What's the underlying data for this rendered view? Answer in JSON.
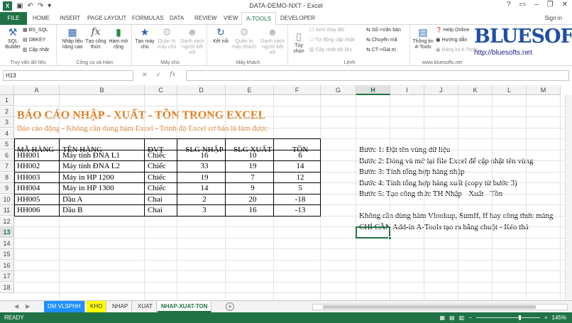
{
  "window": {
    "title": "DATA-DEMO-NXT - Excel",
    "signin": "Sign in"
  },
  "tabs": [
    "FILE",
    "HOME",
    "INSERT",
    "PAGE LAYOUT",
    "FORMULAS",
    "DATA",
    "REVIEW",
    "VIEW",
    "A-TOOLS",
    "DEVELOPER"
  ],
  "active_tab": "A-TOOLS",
  "ribbon": {
    "g1": {
      "sql_builder": "SQL Builder",
      "bs_sql": "BS_SQL",
      "dbkey": "DBKEY",
      "update": "Cập nhật",
      "label": "Truy vấn dữ liệu"
    },
    "g2": {
      "nhap_lieu": "Nhập liệu nâng cao",
      "tao_cong_thuc": "Tạo công thức",
      "ham_mo_rong": "Hàm mở rộng",
      "label": "Công cụ và Hàm"
    },
    "g3": {
      "tao_may_chu": "Tạo máy chủ",
      "quan_tri": "Quản trị máy chủ",
      "danh_sach": "Danh sách người kết nối",
      "label": "Máy chủ"
    },
    "g4": {
      "ket_noi": "Kết nối",
      "quan_tri_kh": "Quản trị máy khách",
      "danh_sach_kh": "Danh sách người kết nối",
      "label": "Máy khách"
    },
    "g5": {
      "xem_thay_doi": "Xem thay đổi",
      "tu_dong": "Tự động cập nhật",
      "cap_nhat_dl": "Cập nhật dữ liệu",
      "tuy_chon": "Tùy chọn",
      "so_van_ban": "Số->Văn bản",
      "chuyen_ma": "Chuyển mã",
      "ct_gia_tri": "CT->Giá trị",
      "label": "Lệnh"
    },
    "g6": {
      "thong_tin": "Thông tin A-Tools",
      "help": "Help Online",
      "huong_dan": "Hướng dẫn",
      "dang_ky": "Đăng ký A-Tools",
      "site": "www.bluesofts.net"
    }
  },
  "logo": {
    "text": "BLUESOFTS",
    "url": "http://bluesofts.net"
  },
  "formula_bar": {
    "namebox": "H13",
    "formula": ""
  },
  "columns": [
    "A",
    "B",
    "C",
    "D",
    "E",
    "F",
    "G",
    "H",
    "I",
    "J",
    "K",
    "L",
    "M"
  ],
  "selected_column": "H",
  "selected_row": "13",
  "rows": [
    "1",
    "2",
    "3",
    "4",
    "5",
    "6",
    "7",
    "8",
    "9",
    "10",
    "11",
    "12",
    "13",
    "14",
    "15",
    "16",
    "17",
    "18"
  ],
  "sheet": {
    "title": "BÁO CÁO NHẬP - XUẤT - TỒN TRONG EXCEL",
    "subtitle": "Báo cáo động - Không cần dùng hàm Excel - Trình độ Excel cơ bản là làm được",
    "headers": [
      "MÃ HÀNG",
      "TÊN HÀNG",
      "ĐVT",
      "SLG NHẬP",
      "SLG XUẤT",
      "TỒN"
    ],
    "data": [
      [
        "HH001",
        "Máy tính ĐNA L1",
        "Chiếc",
        "16",
        "10",
        "6"
      ],
      [
        "HH002",
        "Máy tính ĐNA L2",
        "Chiếc",
        "33",
        "19",
        "14"
      ],
      [
        "HH003",
        "Máy in HP 1200",
        "Chiếc",
        "19",
        "7",
        "12"
      ],
      [
        "HH004",
        "Máy in HP 1300",
        "Chiếc",
        "14",
        "9",
        "5"
      ],
      [
        "HH005",
        "Dầu A",
        "Chai",
        "2",
        "20",
        "-18"
      ],
      [
        "HH006",
        "Dầu B",
        "Chai",
        "3",
        "16",
        "-13"
      ]
    ],
    "steps": [
      "Bước 1: Đặt tên vùng dữ liệu",
      "Bước 2: Đóng và mở lại file Excel để cập nhật tên vùng",
      "Bước 3: Tính tổng hợp hàng nhập",
      "Bước 4: Tính tổng hợp hàng xuất (copy từ bước 3)",
      "Bước 5: Tạo công thức TH Nhập - Xuất - Tồn"
    ],
    "note1": "Không cần dùng hàm Vlookup, SumIf, If hay công thức mảng",
    "note2": "CHỈ CẦN Add-in A-Tools tạo ra bằng chuột - Kéo thả"
  },
  "sheet_tabs": [
    "DM VLSPHH",
    "KHO",
    "NHAP",
    "XUAT",
    "NHAP-XUAT-TON"
  ],
  "active_sheet": "NHAP-XUAT-TON",
  "status": {
    "ready": "READY",
    "zoom": "145%"
  },
  "colors": {
    "excel_green": "#217346",
    "title_orange": "#e07b1a",
    "tab_dm": "#1e90ff",
    "tab_kho": "#ffff00"
  }
}
